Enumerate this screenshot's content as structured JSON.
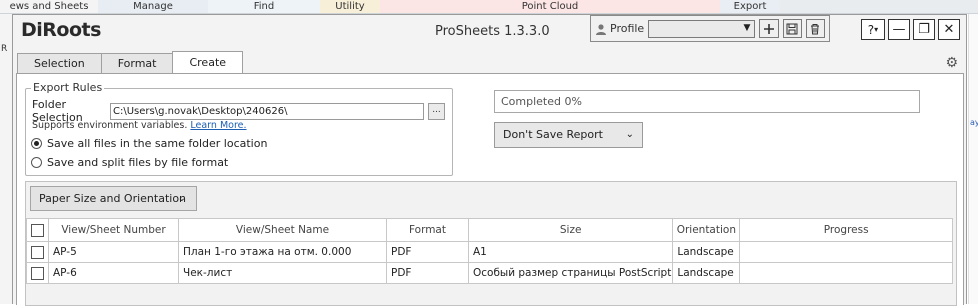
{
  "host": {
    "tabs": [
      "ews and Sheets",
      "Manage",
      "Find",
      "Utility",
      "Point Cloud",
      "Export"
    ],
    "tab_colors": [
      "#f4f4f4",
      "#e7edf3",
      "#eef3f8",
      "#f7efd8",
      "#fbe5e5",
      "#e8eef4"
    ],
    "left_label": "R",
    "right_label": "ay"
  },
  "app": {
    "logo": "DiRoots",
    "title": "ProSheets 1.3.3.0"
  },
  "profile": {
    "label": "Profile",
    "selected": "",
    "add_icon": "plus-icon",
    "save_icon": "floppy-disk-icon",
    "delete_icon": "trash-icon"
  },
  "window_controls": {
    "help": "?",
    "minimize": "—",
    "maximize": "❐",
    "close": "✕"
  },
  "tabs": [
    {
      "label": "Selection",
      "active": false
    },
    {
      "label": "Format",
      "active": false
    },
    {
      "label": "Create",
      "active": true
    }
  ],
  "export_rules": {
    "legend": "Export Rules",
    "folder_label": "Folder Selection",
    "folder_value": "C:\\Users\\g.novak\\Desktop\\240626\\",
    "browse_label": "...",
    "note": "Supports environment variables.",
    "learn_more": "Learn More.",
    "options": [
      {
        "label": "Save all files in the same folder location",
        "selected": true
      },
      {
        "label": "Save and split files by file format",
        "selected": false
      }
    ]
  },
  "status": {
    "progress_text": "Completed 0%",
    "report_label": "Don't Save Report"
  },
  "table": {
    "paper_button": "Paper Size and Orientation",
    "columns": [
      "View/Sheet Number",
      "View/Sheet Name",
      "Format",
      "Size",
      "Orientation",
      "Progress"
    ],
    "rows": [
      {
        "number": "AP-5",
        "name": "План 1-го этажа на отм. 0.000",
        "format": "PDF",
        "size": "A1",
        "orientation": "Landscape",
        "progress": ""
      },
      {
        "number": "AP-6",
        "name": "Чек-лист",
        "format": "PDF",
        "size": "Особый размер страницы PostScript",
        "orientation": "Landscape",
        "progress": ""
      }
    ]
  }
}
